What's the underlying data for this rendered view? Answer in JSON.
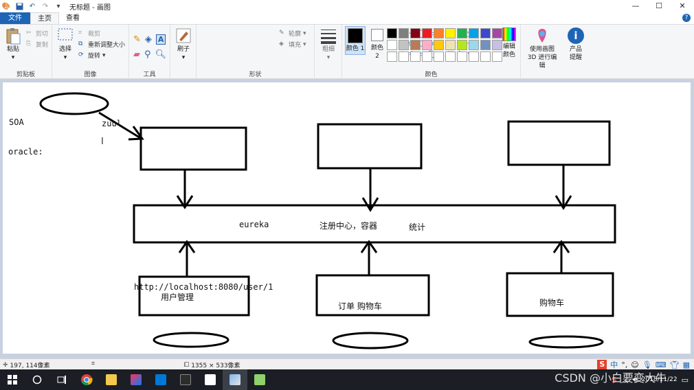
{
  "titlebar": {
    "title": "无标题 - 画图",
    "controls": [
      "—",
      "☐",
      "✕"
    ]
  },
  "tabs": {
    "file": "文件",
    "home": "主页",
    "view": "查看"
  },
  "ribbon": {
    "clipboard": {
      "paste": "粘贴",
      "cut": "剪切",
      "copy": "复制",
      "label": "剪贴板"
    },
    "image": {
      "select": "选择",
      "crop": "裁剪",
      "resize": "重新调整大小",
      "rotate": "旋转",
      "label": "图像"
    },
    "tools": {
      "label": "工具"
    },
    "brushes": {
      "label": "刷子"
    },
    "shapes": {
      "outline": "轮廓",
      "fill": "填充",
      "label": "形状"
    },
    "size": {
      "label": "粗细"
    },
    "colors": {
      "color1": "颜色 1",
      "color2": "颜色 2",
      "edit": "编辑颜色",
      "label": "颜色",
      "palette": [
        "#000000",
        "#7f7f7f",
        "#880015",
        "#ed1c24",
        "#ff7f27",
        "#fff200",
        "#22b14c",
        "#00a2e8",
        "#3f48cc",
        "#a349a4",
        "#ffffff",
        "#c3c3c3",
        "#b97a57",
        "#ffaec9",
        "#ffc90e",
        "#efe4b0",
        "#b5e61d",
        "#99d9ea",
        "#7092be",
        "#c8bfe7",
        "#ffffff",
        "#ffffff",
        "#ffffff",
        "#ffffff",
        "#ffffff",
        "#ffffff",
        "#ffffff",
        "#ffffff",
        "#ffffff",
        "#ffffff"
      ]
    },
    "paint3d": "使用画图 3D 进行编辑",
    "product": "产品提醒"
  },
  "canvas": {
    "soa": "SOA",
    "zuul": "zuul",
    "oracle": "oracle:",
    "eureka": "eureka",
    "registry": "注册中心，容器",
    "stats": "统计",
    "url": "http://localhost:8080/user/1",
    "user_mgmt": "用户管理",
    "order": "订单 购物车",
    "cart": "购物车"
  },
  "statusbar": {
    "cursor_pos": "197, 114像素",
    "image_size": "1355 × 533像素"
  },
  "ime": {
    "lang": "中"
  },
  "taskbar": {
    "apps": [
      "windows",
      "search",
      "taskview",
      "chrome",
      "explorer",
      "intellij",
      "store",
      "app1",
      "typora",
      "paint",
      "notepad"
    ]
  },
  "tray": {
    "date": "2018/11/22"
  },
  "watermark": "CSDN @小白要变大牛"
}
